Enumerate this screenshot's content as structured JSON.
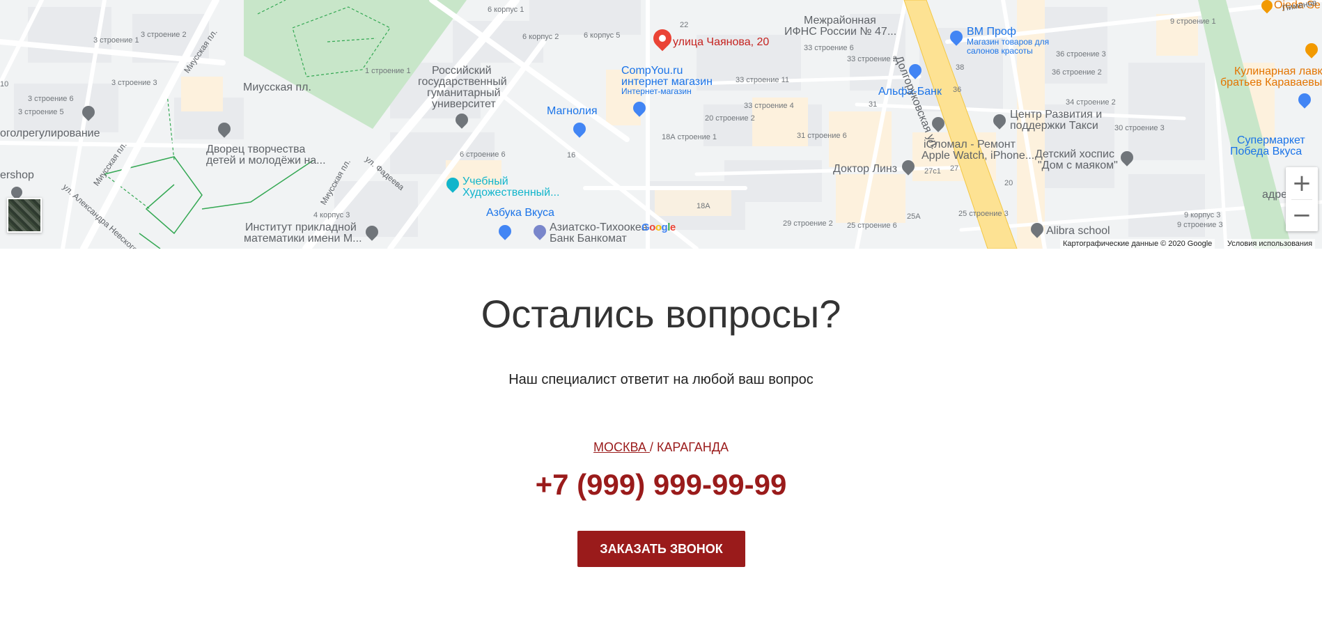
{
  "map": {
    "labels": {
      "chayanova": "улица Чаянова, 20",
      "ifns_1": "Межрайонная",
      "ifns_2": "ИФНС России № 47...",
      "bm_prof": "BM Проф",
      "bm_prof_sub1": "Магазин товаров для",
      "bm_prof_sub2": "салонов красоты",
      "rggu_1": "Российский",
      "rggu_2": "государственный",
      "rggu_3": "гуманитарный",
      "rggu_4": "университет",
      "miusskaya": "Миусская пл.",
      "compyou_1": "CompYou.ru",
      "compyou_2": "интернет магазин",
      "compyou_sub": "Интернет-магазин",
      "magnolia": "Магнолия",
      "alfa": "Альфа-Банк",
      "taxi_1": "Центр Развития и",
      "taxi_2": "поддержки Такси",
      "icomal_1": "iCломал - Ремонт",
      "icomal_2": "Apple Watch, iPhone...",
      "hospice_1": "Детский хоспис",
      "hospice_2": "\"Дом с маяком\"",
      "lenz": "Доктор Линз",
      "dvorec_1": "Дворец творчества",
      "dvorec_2": "детей и молодёжи на...",
      "uchebny_1": "Учебный",
      "uchebny_2": "Художественный...",
      "azbuka": "Азбука Вкуса",
      "atb_1": "Азиатско-Тихоокеа",
      "atb_2": "Банк Банкомат",
      "institut_1": "Институт прикладной",
      "institut_2": "математики имени М...",
      "alibra": "Alibra school",
      "kulinar_1": "Кулинарная лавка",
      "kulinar_2": "братьев Караваевы",
      "pobeda_1": "Супермаркет",
      "pobeda_2": "Победа Вкуса",
      "ojeda": "Ojeda Se",
      "adres": "адре",
      "ugol": "оголрегулирование",
      "barber": "ershop",
      "dolgorukovskaya": "Долгоруковская ул.",
      "miusskaya_pl_road": "Миусская пл.",
      "fadeeva": "ул. Фадеева",
      "nevskogo": "ул. Александра Невского",
      "pimenov": "Пименов"
    },
    "small_labels": [
      "6 корпус 1",
      "6 корпус 2",
      "6 корпус 5",
      "22",
      "33 строение 6",
      "33 строение 2",
      "33 строение 11",
      "33 строение 4",
      "20 строение 2",
      "31 строение 6",
      "18А строение 1",
      "18А",
      "16",
      "6 строение 6",
      "1 строение 1",
      "3 строение 2",
      "3 строение 1",
      "3 строение 3",
      "3 строение 5",
      "3 строение 6",
      "29 строение 2",
      "25 строение 6",
      "25А",
      "25 строение 3",
      "27с1",
      "27",
      "20",
      "31",
      "36",
      "38",
      "36 строение 2",
      "36 строение 3",
      "34 строение 2",
      "30 строение 3",
      "9 строение 1",
      "9 строение 3",
      "9 корпус 3",
      "4 корпус 3",
      "10"
    ],
    "attribution": "Картографические данные © 2020 Google",
    "terms": "Условия использования",
    "google_logo": "Google",
    "zoom_in": "+",
    "zoom_out": "−"
  },
  "contact": {
    "title": "Остались вопросы?",
    "subtitle": "Наш специалист ответит на любой ваш вопрос",
    "city_active": "МОСКВА ",
    "city_sep": "/ ",
    "city_other": "КАРАГАНДА",
    "phone": "+7 (999) 999-99-99",
    "button": "ЗАКАЗАТЬ ЗВОНОК"
  },
  "colors": {
    "accent": "#9a1b1b",
    "title": "#333333",
    "map_bg": "#f1f3f4",
    "park": "#c8e6c9",
    "main_road": "#fde293"
  }
}
